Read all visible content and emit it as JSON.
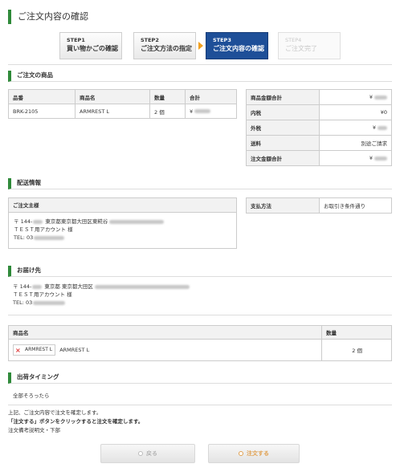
{
  "page_title": "ご注文内容の確認",
  "steps": [
    {
      "num": "STEP1",
      "label": "買い物かごの確認",
      "state": "done"
    },
    {
      "num": "STEP2",
      "label": "ご注文方法の指定",
      "state": "done"
    },
    {
      "num": "STEP3",
      "label": "ご注文内容の確認",
      "state": "active"
    },
    {
      "num": "STEP4",
      "label": "ご注文完了",
      "state": "disabled"
    }
  ],
  "products_section": {
    "title": "ご注文の商品",
    "columns": [
      "品番",
      "商品名",
      "数量",
      "合計"
    ],
    "rows": [
      {
        "code": "BRK-2105",
        "name": "ARMREST L",
        "qty": "2 個",
        "total": "¥"
      }
    ]
  },
  "summary": {
    "rows": [
      {
        "label": "商品金額合計",
        "value": "¥"
      },
      {
        "label": "内税",
        "value": "¥0"
      },
      {
        "label": "外税",
        "value": "¥"
      },
      {
        "label": "送料",
        "value": "別途ご請求"
      },
      {
        "label": "注文金額合計",
        "value": "¥"
      }
    ]
  },
  "delivery_section": {
    "title": "配送情報",
    "owner_header": "ご注文主様",
    "owner_postal": "〒 144-",
    "owner_address": "東京都東京都大田区東糀谷",
    "owner_name": "ＴＥＳＴ用アカウント 様",
    "owner_tel": "TEL: 03",
    "payment_label": "支払方法",
    "payment_value": "お取引き条件通り"
  },
  "ship_to_section": {
    "title": "お届け先",
    "postal": "〒 144-",
    "address": "東京都 東京都大田区",
    "name": "ＴＥＳＴ用アカウント 様",
    "tel": "TEL: 03"
  },
  "ship_items": {
    "columns": [
      "商品名",
      "数量"
    ],
    "rows": [
      {
        "thumb_alt": "ARMREST L",
        "name": "ARMREST L",
        "qty": "2 個"
      }
    ]
  },
  "timing_section": {
    "title": "出荷タイミング",
    "value": "全部そろったら"
  },
  "notes": {
    "line1": "上記、ご注文内容で注文を確定します。",
    "line2": "「注文する」ボタンをクリックすると注文を確定します。",
    "line3": "注文備考説明文・下部"
  },
  "buttons": {
    "back": "戻る",
    "order": "注文する"
  },
  "colors": {
    "accent_green": "#2f8a3a",
    "step_active": "#1e4f98",
    "step_arrow": "#f0a020",
    "order_text": "#e0a050"
  }
}
